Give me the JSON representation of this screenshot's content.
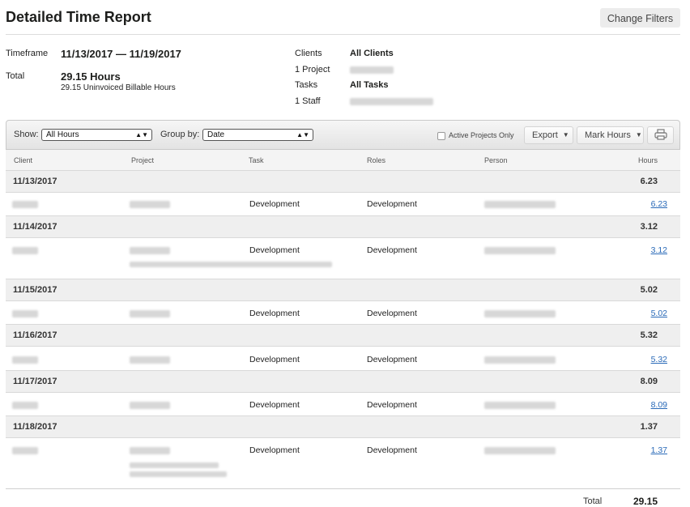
{
  "header": {
    "title": "Detailed Time Report",
    "change_filters": "Change Filters"
  },
  "summary": {
    "timeframe_label": "Timeframe",
    "timeframe_value": "11/13/2017 — 11/19/2017",
    "total_label": "Total",
    "total_value": "29.15 Hours",
    "total_sub": "29.15 Uninvoiced Billable Hours",
    "clients_label": "Clients",
    "clients_value": "All Clients",
    "project_label": "1 Project",
    "tasks_label": "Tasks",
    "tasks_value": "All Tasks",
    "staff_label": "1 Staff"
  },
  "toolbar": {
    "show_label": "Show:",
    "show_value": "All Hours",
    "groupby_label": "Group by:",
    "groupby_value": "Date",
    "active_projects": "Active Projects Only",
    "export": "Export",
    "mark_hours": "Mark Hours"
  },
  "columns": {
    "client": "Client",
    "project": "Project",
    "task": "Task",
    "roles": "Roles",
    "person": "Person",
    "hours": "Hours"
  },
  "groups": [
    {
      "date": "11/13/2017",
      "hours": "6.23",
      "task": "Development",
      "role": "Development",
      "entry_hours": "6.23"
    },
    {
      "date": "11/14/2017",
      "hours": "3.12",
      "task": "Development",
      "role": "Development",
      "entry_hours": "3.12"
    },
    {
      "date": "11/15/2017",
      "hours": "5.02",
      "task": "Development",
      "role": "Development",
      "entry_hours": "5.02"
    },
    {
      "date": "11/16/2017",
      "hours": "5.32",
      "task": "Development",
      "role": "Development",
      "entry_hours": "5.32"
    },
    {
      "date": "11/17/2017",
      "hours": "8.09",
      "task": "Development",
      "role": "Development",
      "entry_hours": "8.09"
    },
    {
      "date": "11/18/2017",
      "hours": "1.37",
      "task": "Development",
      "role": "Development",
      "entry_hours": "1.37"
    }
  ],
  "footer": {
    "total_label": "Total",
    "total_value": "29.15"
  }
}
